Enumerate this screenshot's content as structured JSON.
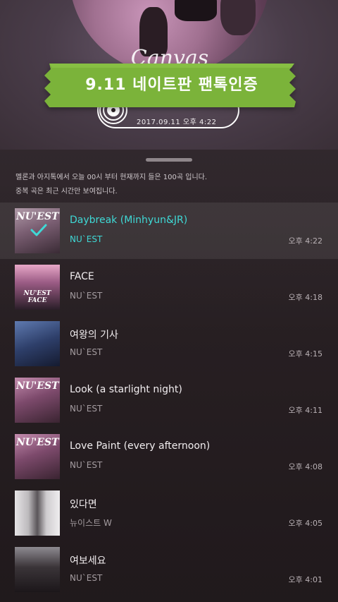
{
  "banner": {
    "text": "9.11 네이트판 팬톡인증"
  },
  "certificate": {
    "datetime": "2017.09.11 오후 4:22",
    "icon": "disc-icon"
  },
  "album_art": {
    "script_text": "Canvas"
  },
  "notice": {
    "line1": "멜론과 아지톡에서 오늘 00시 부터 현재까지 들은 100곡 입니다.",
    "line2": "중복 곡은 최근 시간만 보여집니다."
  },
  "colors": {
    "accent": "#3fd9d6",
    "banner_green": "#7bb33a"
  },
  "songs": [
    {
      "title": "Daybreak (Minhyun&JR)",
      "artist": "NU`EST",
      "time": "오후 4:22",
      "thumb_text": "NU'EST",
      "selected": true
    },
    {
      "title": "FACE",
      "artist": "NU`EST",
      "time": "오후 4:18",
      "thumb_text": "NU'EST FACE",
      "selected": false
    },
    {
      "title": "여왕의 기사",
      "artist": "NU`EST",
      "time": "오후 4:15",
      "thumb_text": "",
      "selected": false
    },
    {
      "title": "Look (a starlight night)",
      "artist": "NU`EST",
      "time": "오후 4:11",
      "thumb_text": "NU'EST",
      "selected": false
    },
    {
      "title": "Love Paint (every afternoon)",
      "artist": "NU`EST",
      "time": "오후 4:08",
      "thumb_text": "NU'EST",
      "selected": false
    },
    {
      "title": "있다면",
      "artist": "뉴이스트 W",
      "time": "오후 4:05",
      "thumb_text": "",
      "selected": false
    },
    {
      "title": "여보세요",
      "artist": "NU`EST",
      "time": "오후 4:01",
      "thumb_text": "",
      "selected": false
    }
  ]
}
